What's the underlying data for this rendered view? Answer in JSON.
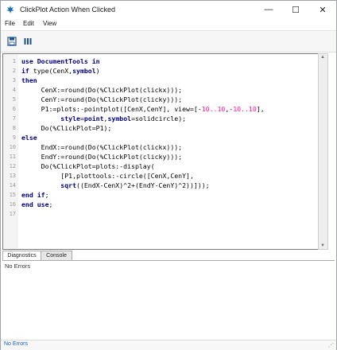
{
  "window": {
    "title": "ClickPlot Action When Clicked",
    "controls": {
      "minimize": "—",
      "maximize": "☐",
      "close": "✕"
    }
  },
  "menubar": {
    "items": [
      "File",
      "Edit",
      "View"
    ]
  },
  "toolbar": {
    "icons": [
      "save-icon",
      "columns-icon"
    ]
  },
  "editor": {
    "lines": [
      [
        [
          "kw",
          "use DocumentTools in"
        ]
      ],
      [
        [
          "kw",
          "if "
        ],
        [
          "",
          "type(CenX,"
        ],
        [
          "kw",
          "symbol"
        ],
        [
          "",
          ")"
        ]
      ],
      [
        [
          "kw",
          "then"
        ]
      ],
      [
        [
          "",
          "     CenX:=round(Do(%ClickPlot(clickx)));"
        ]
      ],
      [
        [
          "",
          "     CenY:=round(Do(%ClickPlot(clicky)));"
        ]
      ],
      [
        [
          "",
          "     P1:=plots:-pointplot([CenX,CenY], view=[-"
        ],
        [
          "hl",
          "10..10"
        ],
        [
          "",
          ",-"
        ],
        [
          "hl",
          "10..10"
        ],
        [
          "",
          "],"
        ]
      ],
      [
        [
          "",
          "          "
        ],
        [
          "kw",
          "style"
        ],
        [
          "",
          "="
        ],
        [
          "kw",
          "point"
        ],
        [
          "",
          ","
        ],
        [
          "kw",
          "symbol"
        ],
        [
          "",
          "=solidcircle);"
        ]
      ],
      [
        [
          "",
          "     Do(%ClickPlot=P1);"
        ]
      ],
      [
        [
          "kw",
          "else"
        ]
      ],
      [
        [
          "",
          "     EndX:=round(Do(%ClickPlot(clickx)));"
        ]
      ],
      [
        [
          "",
          "     EndY:=round(Do(%ClickPlot(clicky)));"
        ]
      ],
      [
        [
          "",
          "     Do(%ClickPlot=plots:-display("
        ]
      ],
      [
        [
          "",
          "          [P1,plottools:-circle([CenX,CenY],"
        ]
      ],
      [
        [
          "",
          "          "
        ],
        [
          "kw",
          "sqrt"
        ],
        [
          "",
          "((EndX-CenX)^2+(EndY-CenY)^2))]));"
        ]
      ],
      [
        [
          "kw",
          "end if"
        ],
        [
          "",
          ";"
        ]
      ],
      [
        [
          "kw",
          "end use"
        ],
        [
          "",
          ";"
        ]
      ],
      [
        [
          "",
          ""
        ]
      ]
    ]
  },
  "bottom_tabs": {
    "items": [
      "Diagnostics",
      "Console"
    ],
    "active": 0
  },
  "output": {
    "text": "No Errors"
  },
  "status": {
    "text": "No Errors"
  },
  "colors": {
    "keyword": "#00007f",
    "highlight": "#ff1493",
    "status": "#1a5fbf"
  }
}
